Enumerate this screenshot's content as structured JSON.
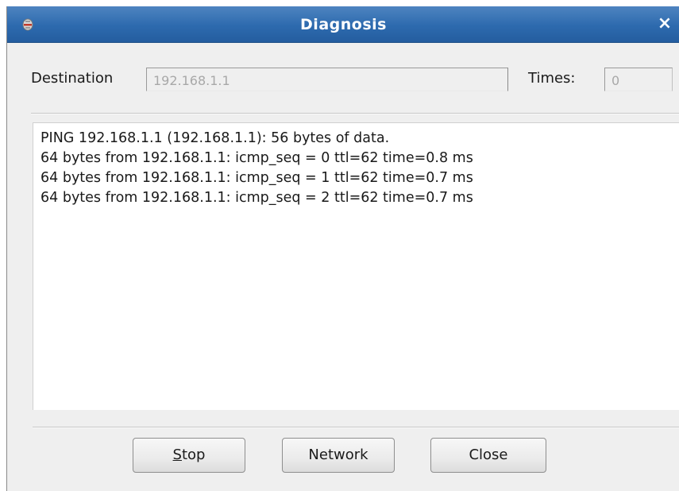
{
  "window": {
    "title": "Diagnosis",
    "close_glyph": "×",
    "app_icon": "app-icon",
    "titlebar_color": "#2d6aae"
  },
  "form": {
    "destination_label": "Destination",
    "destination_value": "192.168.1.1",
    "times_label": "Times:",
    "times_value": "0"
  },
  "output": {
    "lines": [
      "PING 192.168.1.1 (192.168.1.1): 56 bytes of data.",
      "64 bytes from 192.168.1.1: icmp_seq = 0 ttl=62 time=0.8 ms",
      "64 bytes from 192.168.1.1: icmp_seq = 1 ttl=62 time=0.7 ms",
      "64 bytes from 192.168.1.1: icmp_seq = 2 ttl=62 time=0.7 ms"
    ]
  },
  "buttons": {
    "stop_mnemonic": "S",
    "stop_rest": "top",
    "network": "Network",
    "close": "Close"
  }
}
